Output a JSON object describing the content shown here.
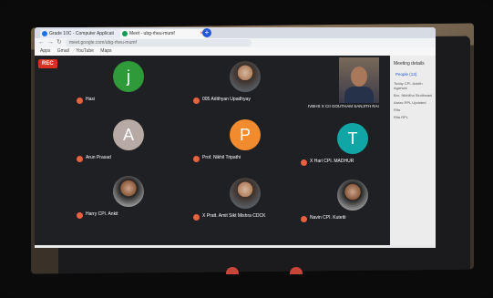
{
  "browser": {
    "tabs": [
      {
        "label": "Grade 10C - Computer Applicati",
        "favicon_color": "#1a73e8"
      },
      {
        "label": "Meet - ubg-rheu-mumf",
        "favicon_color": "#0f9d58"
      }
    ],
    "url": "meet.google.com/ubg-rheu-mumf",
    "bookmarks": [
      "Apps",
      "Gmail",
      "YouTube",
      "Maps"
    ]
  },
  "meet": {
    "rec_label": "REC",
    "participants": [
      {
        "initial": "j",
        "color": "#2f9a3a",
        "name": "Hasi"
      },
      {
        "initial": "",
        "color": "",
        "name": "005 Adithyan Upadhyay"
      },
      {
        "initial": "A",
        "color": "#b7aaa4",
        "name": "Arun Prasad"
      },
      {
        "initial": "P",
        "color": "#f28a2e",
        "name": "Prof. Nikhil Tripathi"
      },
      {
        "initial": "T",
        "color": "#11a6a6",
        "name": "X Hari CPI. MADHUR"
      },
      {
        "initial": "",
        "color": "",
        "name": "Harry CPI. Ankit"
      },
      {
        "initial": "",
        "color": "",
        "name": "X Pratt. Amit Sikt Mishra CDCK"
      },
      {
        "initial": "",
        "color": "",
        "name": "Navin CPI. Kutetti"
      }
    ],
    "self_name": "IVBHS X CII GOUTHAM SANJITH RAI"
  },
  "side_panel": {
    "title": "Meeting details",
    "people_label": "People (13)",
    "lines": [
      "Today CPI. Ankith Agarwal",
      "Bro. Nikhilha Sindhwani",
      "Aarav RPL Updated",
      "Rita",
      "Rita RPL"
    ]
  }
}
